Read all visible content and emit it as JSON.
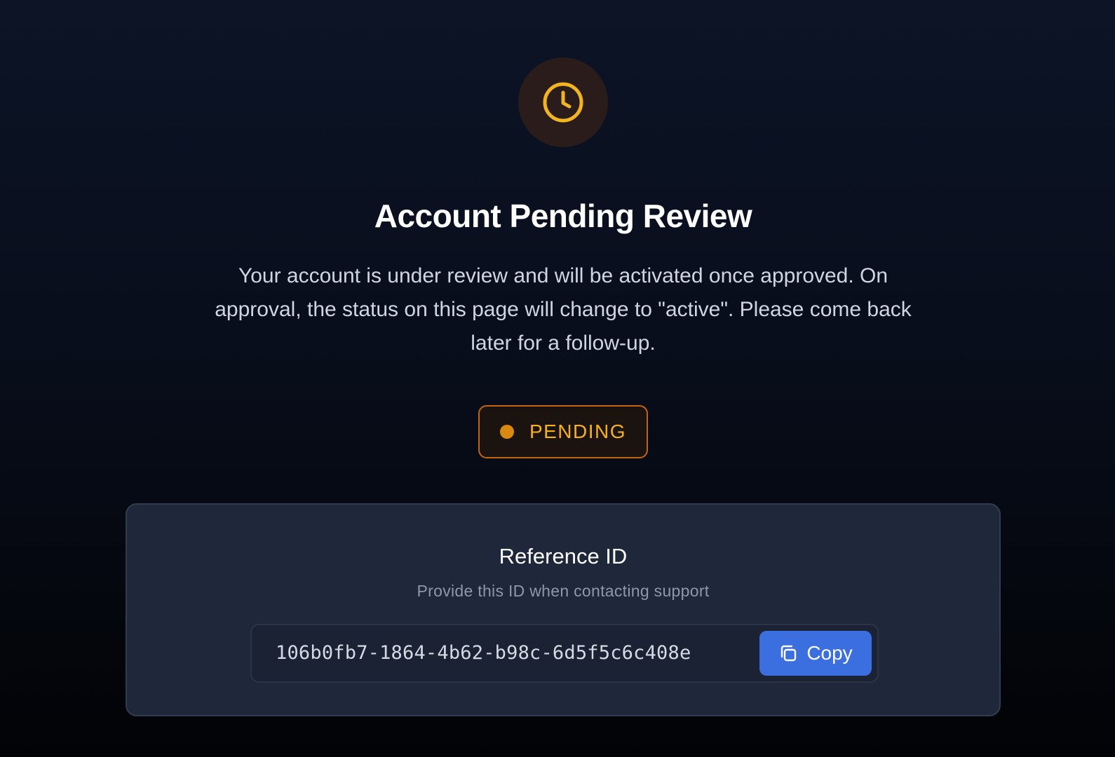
{
  "header": {
    "icon": "clock-icon",
    "title": "Account Pending Review",
    "description": "Your account is under review and will be activated once approved. On approval, the status on this page will change to \"active\". Please come back later for a follow-up."
  },
  "status": {
    "label": "PENDING",
    "dot_color": "#d98a0e",
    "text_color": "#f5b020",
    "border_color": "#c2650d"
  },
  "reference": {
    "title": "Reference ID",
    "subtitle": "Provide this ID when contacting support",
    "id": "106b0fb7-1864-4b62-b98c-6d5f5c6c408e",
    "copy_label": "Copy",
    "copy_icon": "copy-icon"
  },
  "colors": {
    "accent": "#3b6ede",
    "icon_color": "#f2b41f",
    "background_top": "#0c1426",
    "card_background": "#1f273a"
  }
}
